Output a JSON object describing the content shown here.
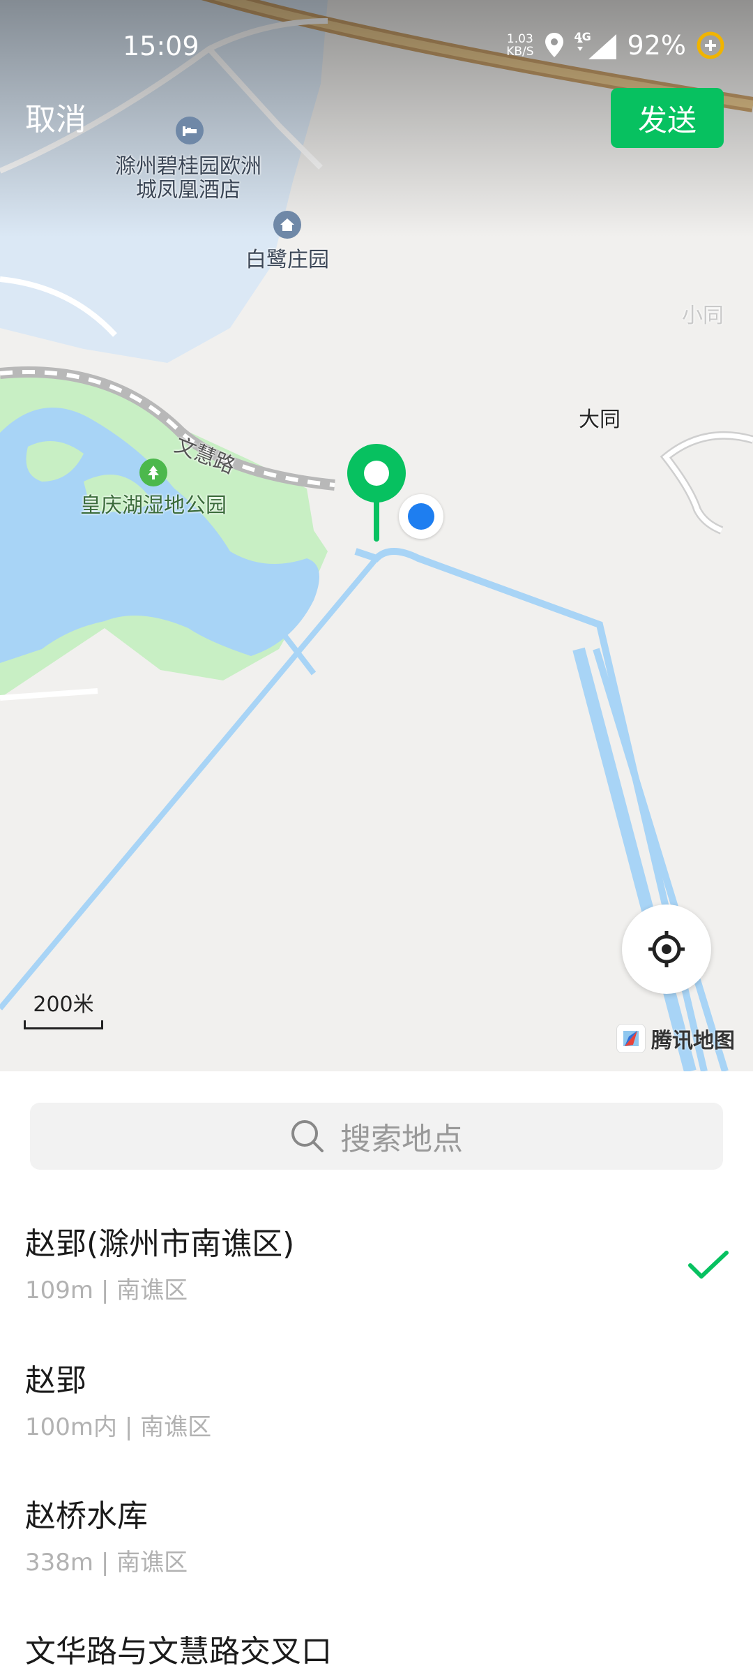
{
  "status_bar": {
    "time": "15:09",
    "net_speed_value": "1.03",
    "net_speed_unit": "KB/S",
    "network": "4G",
    "battery": "92%"
  },
  "header": {
    "cancel_label": "取消",
    "send_label": "发送"
  },
  "map": {
    "pois": [
      {
        "name": "滁州碧桂园欧洲城凤凰酒店",
        "line1": "滁州碧桂园欧洲",
        "line2": "城凤凰酒店",
        "icon": "hotel-icon"
      },
      {
        "name": "白鹭庄园",
        "icon": "home-icon"
      },
      {
        "name": "皇庆湖湿地公园",
        "icon": "park-icon"
      },
      {
        "name": "大同"
      },
      {
        "name": "小同"
      }
    ],
    "road_label": "文慧路",
    "scale_label": "200米",
    "provider": "腾讯地图",
    "colors": {
      "water": "#a8d4f6",
      "park": "#c8efc4",
      "pin": "#07c160",
      "my_location": "#1e7ef0"
    }
  },
  "search": {
    "placeholder": "搜索地点"
  },
  "results": [
    {
      "title": "赵郢(滁州市南谯区)",
      "subtitle": "109m | 南谯区",
      "selected": true
    },
    {
      "title": "赵郢",
      "subtitle": "100m内 | 南谯区",
      "selected": false
    },
    {
      "title": "赵桥水库",
      "subtitle": "338m | 南谯区",
      "selected": false
    },
    {
      "title": "文华路与文慧路交叉口",
      "subtitle": "",
      "selected": false
    }
  ],
  "accent_color": "#07c160"
}
